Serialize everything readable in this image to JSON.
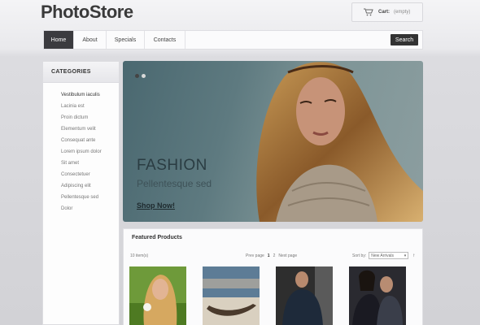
{
  "header": {
    "logo": "PhotoStore",
    "cart_label": "Cart:",
    "cart_status": "(empty)"
  },
  "nav": {
    "items": [
      {
        "label": "Home",
        "active": true
      },
      {
        "label": "About",
        "active": false
      },
      {
        "label": "Specials",
        "active": false
      },
      {
        "label": "Contacts",
        "active": false
      }
    ],
    "search_button": "Search",
    "search_placeholder": ""
  },
  "sidebar": {
    "title": "CATEGORIES",
    "items": [
      "Vestibulum iaculis",
      "Lacinia est",
      "Proin dictum",
      "Elementum velit",
      "Consequat ante",
      "Lorem ipsum dolor",
      "Sit amet",
      "Consectetuer",
      "Adipiscing elit",
      "Pellentesque sed",
      "Dolor"
    ]
  },
  "banner": {
    "title": "FASHION",
    "subtitle": "Pellentesque sed",
    "cta": "Shop Now!",
    "slide_count": 2,
    "active_slide": 1
  },
  "products": {
    "title": "Featured Products",
    "count_text": "10 item(s)",
    "pager": {
      "prev": "Prev page",
      "pages": [
        "1",
        "2"
      ],
      "current": "1",
      "next": "Next page"
    },
    "sort_label": "Sort by:",
    "sort_value": "New Arrivals",
    "thumbnails": [
      {
        "name": "product-thumb-woman-field"
      },
      {
        "name": "product-thumb-boat-beach"
      },
      {
        "name": "product-thumb-man-jacket"
      },
      {
        "name": "product-thumb-couple"
      }
    ]
  },
  "colors": {
    "nav_active": "#3b3b3f",
    "accent_dark": "#333333"
  }
}
